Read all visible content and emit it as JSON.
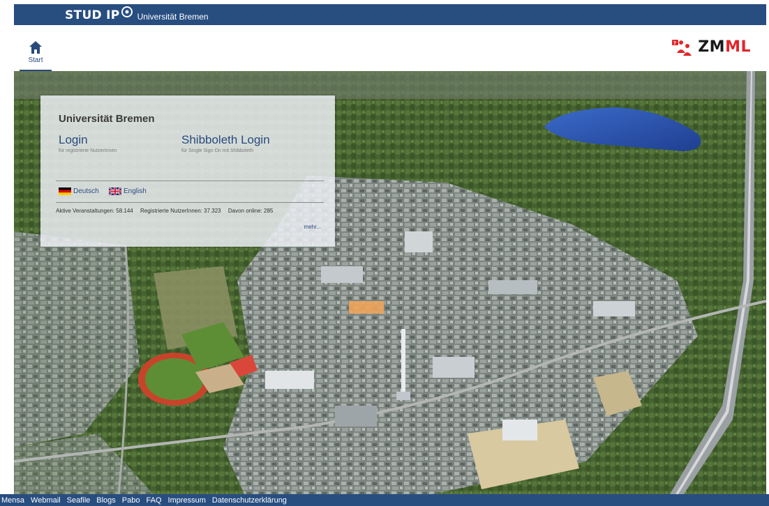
{
  "header": {
    "logo_text": "STUD IP",
    "institution": "Universität Bremen"
  },
  "nav": {
    "start_label": "Start",
    "partner_logo_text_dark": "ZM",
    "partner_logo_text_red": "ML"
  },
  "login_panel": {
    "title": "Universität Bremen",
    "login_label": "Login",
    "login_sub": "für registrierte NutzerInnen",
    "shibboleth_label": "Shibboleth Login",
    "shibboleth_sub": "für Single Sign On mit Shibboleth",
    "languages": [
      {
        "label": "Deutsch",
        "flag": "germany-flag-icon"
      },
      {
        "label": "English",
        "flag": "uk-flag-icon"
      }
    ],
    "stats": [
      "Aktive Veranstaltungen: 58.144",
      "Registrierte NutzerInnen: 37.323",
      "Davon online: 285"
    ],
    "more_label": "mehr..."
  },
  "footer": {
    "links": [
      "Mensa",
      "Webmail",
      "Seafile",
      "Blogs",
      "Pabo",
      "FAQ",
      "Impressum",
      "Datenschutzerklärung"
    ]
  },
  "colors": {
    "brand_blue": "#284e80",
    "link_blue": "#28497c",
    "zmml_red": "#e1262a"
  }
}
